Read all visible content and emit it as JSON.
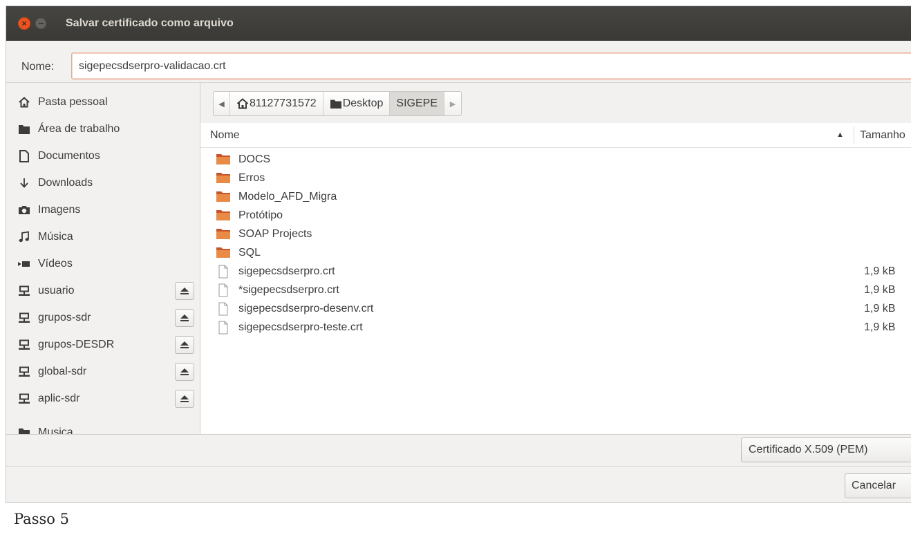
{
  "window": {
    "title": "Salvar certificado como arquivo",
    "close_glyph": "×"
  },
  "name_field": {
    "label": "Nome:",
    "value": "sigepecsdserpro-validacao.crt"
  },
  "sidebar": {
    "items": [
      {
        "label": "Pasta pessoal",
        "icon": "home-icon",
        "eject": false
      },
      {
        "label": "Área de trabalho",
        "icon": "folder-icon",
        "eject": false
      },
      {
        "label": "Documentos",
        "icon": "document-icon",
        "eject": false
      },
      {
        "label": "Downloads",
        "icon": "download-icon",
        "eject": false
      },
      {
        "label": "Imagens",
        "icon": "camera-icon",
        "eject": false
      },
      {
        "label": "Música",
        "icon": "music-icon",
        "eject": false
      },
      {
        "label": "Vídeos",
        "icon": "video-icon",
        "eject": false
      },
      {
        "label": "usuario",
        "icon": "network-drive-icon",
        "eject": true
      },
      {
        "label": "grupos-sdr",
        "icon": "network-drive-icon",
        "eject": true
      },
      {
        "label": "grupos-DESDR",
        "icon": "network-drive-icon",
        "eject": true
      },
      {
        "label": "global-sdr",
        "icon": "network-drive-icon",
        "eject": true
      },
      {
        "label": "aplic-sdr",
        "icon": "network-drive-icon",
        "eject": true
      },
      {
        "label": "Musica",
        "icon": "folder-icon",
        "eject": false
      }
    ]
  },
  "path_bar": {
    "back_glyph": "◀",
    "forward_glyph": "▶",
    "segments": [
      {
        "label": "81127731572",
        "icon": "home-icon",
        "active": false
      },
      {
        "label": "Desktop",
        "icon": "folder-icon",
        "active": false
      },
      {
        "label": "SIGEPE",
        "icon": "",
        "active": true
      }
    ]
  },
  "columns": {
    "name": "Nome",
    "size": "Tamanho",
    "sort_glyph": "▲"
  },
  "files": [
    {
      "name": "DOCS",
      "type": "folder",
      "size": ""
    },
    {
      "name": "Erros",
      "type": "folder",
      "size": ""
    },
    {
      "name": "Modelo_AFD_Migra",
      "type": "folder",
      "size": ""
    },
    {
      "name": "Protótipo",
      "type": "folder",
      "size": ""
    },
    {
      "name": "SOAP Projects",
      "type": "folder",
      "size": ""
    },
    {
      "name": "SQL",
      "type": "folder",
      "size": ""
    },
    {
      "name": "sigepecsdserpro.crt",
      "type": "file",
      "size": "1,9 kB"
    },
    {
      "name": "*sigepecsdserpro.crt",
      "type": "file",
      "size": "1,9 kB"
    },
    {
      "name": "sigepecsdserpro-desenv.crt",
      "type": "file",
      "size": "1,9 kB"
    },
    {
      "name": "sigepecsdserpro-teste.crt",
      "type": "file",
      "size": "1,9 kB"
    }
  ],
  "filter": {
    "selected": "Certificado X.509 (PEM)"
  },
  "actions": {
    "cancel_label": "Cancelar"
  },
  "caption": "Passo 5",
  "colors": {
    "titlebar": "#3c3b37",
    "close_button": "#e95420",
    "folder": "#e27a3f",
    "input_focus": "#e9a88e"
  }
}
